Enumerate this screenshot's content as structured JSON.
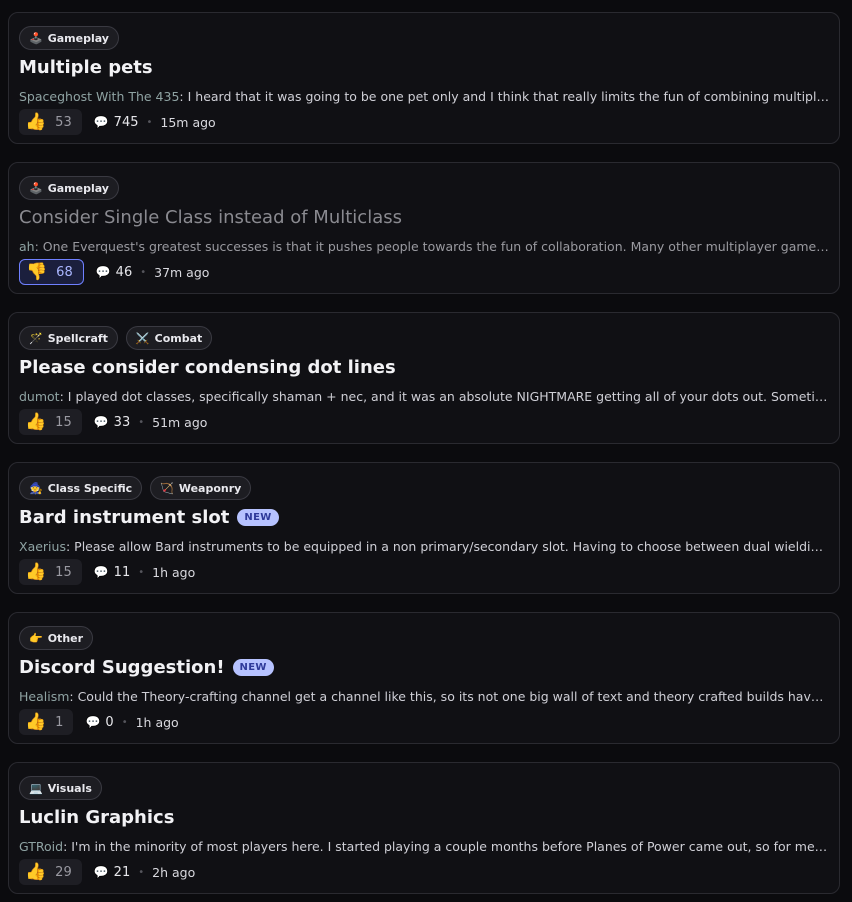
{
  "posts": [
    {
      "tags": [
        {
          "icon": "🕹️",
          "icon_name": "joystick-icon",
          "label": "Gameplay"
        }
      ],
      "title": "Multiple pets",
      "is_new": false,
      "author": "Spaceghost With The 435",
      "excerpt": ": I heard that it was going to be one pet only and I think that really limits the fun of combining multiple pet classes and abilities in interesting ways…",
      "vote_type": "up",
      "vote_icon": "👍",
      "votes": "53",
      "comments": "745",
      "time": "15m ago",
      "dim": false,
      "vote_active": false
    },
    {
      "tags": [
        {
          "icon": "🕹️",
          "icon_name": "joystick-icon",
          "label": "Gameplay"
        }
      ],
      "title": "Consider Single Class instead of Multiclass",
      "is_new": false,
      "author": "ah",
      "excerpt": ": One Everquest's greatest successes is that it pushes people towards the fun of collaboration. Many other multiplayer games do this poorly…",
      "vote_type": "down",
      "vote_icon": "👎",
      "votes": "68",
      "comments": "46",
      "time": "37m ago",
      "dim": true,
      "vote_active": true
    },
    {
      "tags": [
        {
          "icon": "🪄",
          "icon_name": "magic-wand-icon",
          "label": "Spellcraft"
        },
        {
          "icon": "⚔️",
          "icon_name": "crossed-swords-icon",
          "label": "Combat"
        }
      ],
      "title": "Please consider condensing dot lines",
      "is_new": false,
      "author": "dumot",
      "excerpt": ": I played dot classes, specifically shaman + nec, and it was an absolute NIGHTMARE getting all of your dots out. Sometimes, little else mattered…",
      "vote_type": "up",
      "vote_icon": "👍",
      "votes": "15",
      "comments": "33",
      "time": "51m ago",
      "dim": false,
      "vote_active": false
    },
    {
      "tags": [
        {
          "icon": "🧙",
          "icon_name": "wizard-icon",
          "label": "Class Specific"
        },
        {
          "icon": "🏹",
          "icon_name": "bow-and-arrow-icon",
          "label": "Weaponry"
        }
      ],
      "title": "Bard instrument slot",
      "is_new": true,
      "author": "Xaerius",
      "excerpt": ": Please allow Bard instruments to be equipped in a non primary/secondary slot. Having to choose between dual wielding or using instruments…",
      "vote_type": "up",
      "vote_icon": "👍",
      "votes": "15",
      "comments": "11",
      "time": "1h ago",
      "dim": false,
      "vote_active": false
    },
    {
      "tags": [
        {
          "icon": "👉",
          "icon_name": "pointing-hand-icon",
          "label": "Other"
        }
      ],
      "title": "Discord Suggestion!",
      "is_new": true,
      "author": "Healism",
      "excerpt": ": Could the Theory-crafting channel get a channel like this, so its not one big wall of text and theory crafted builds have their own place…",
      "vote_type": "up",
      "vote_icon": "👍",
      "votes": "1",
      "comments": "0",
      "time": "1h ago",
      "dim": false,
      "vote_active": false
    },
    {
      "tags": [
        {
          "icon": "💻",
          "icon_name": "laptop-icon",
          "label": "Visuals"
        }
      ],
      "title": "Luclin Graphics",
      "is_new": false,
      "author": "GTRoid",
      "excerpt": ": I'm in the minority of most players here. I started playing a couple months before Planes of Power came out, so for me, Luclin graphics were the norm…",
      "vote_type": "up",
      "vote_icon": "👍",
      "votes": "29",
      "comments": "21",
      "time": "2h ago",
      "dim": false,
      "vote_active": false
    }
  ],
  "new_badge_label": "NEW",
  "comment_icon": "💬"
}
